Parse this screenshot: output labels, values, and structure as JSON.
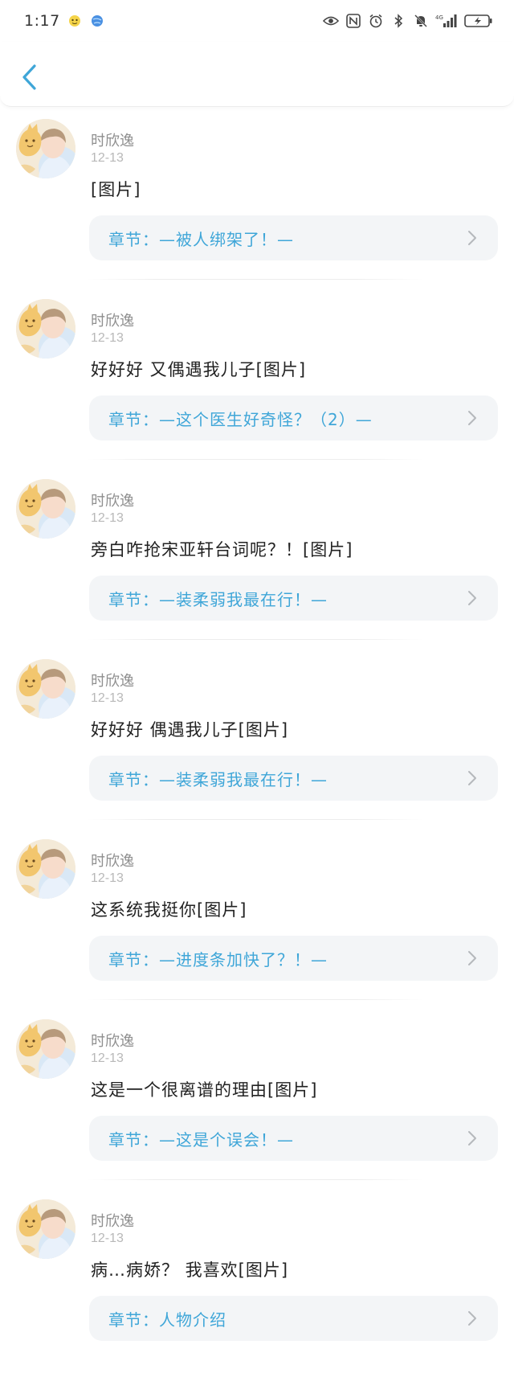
{
  "status_bar": {
    "time": "1:17",
    "network": "4G",
    "icons": [
      "face-icon",
      "globe-icon",
      "eye-icon",
      "nfc-icon",
      "alarm-icon",
      "bluetooth-icon",
      "mute-icon",
      "signal-icon",
      "battery-icon"
    ]
  },
  "header": {
    "back_icon": "chevron-left-icon"
  },
  "colors": {
    "accent": "#3fa6d8",
    "card_bg": "#f3f5f7",
    "author": "#8f8f8f",
    "date": "#b8b8b8"
  },
  "comments": [
    {
      "author": "时欣逸",
      "date": "12-13",
      "text": "[图片]",
      "chapter": "章节：—被人绑架了！—"
    },
    {
      "author": "时欣逸",
      "date": "12-13",
      "text": "好好好 又偶遇我儿子[图片]",
      "chapter": "章节：—这个医生好奇怪？（2）—"
    },
    {
      "author": "时欣逸",
      "date": "12-13",
      "text": "旁白咋抢宋亚轩台词呢？！[图片]",
      "chapter": "章节：—装柔弱我最在行！—"
    },
    {
      "author": "时欣逸",
      "date": "12-13",
      "text": "好好好 偶遇我儿子[图片]",
      "chapter": "章节：—装柔弱我最在行！—"
    },
    {
      "author": "时欣逸",
      "date": "12-13",
      "text": "这系统我挺你[图片]",
      "chapter": "章节：—进度条加快了？！—"
    },
    {
      "author": "时欣逸",
      "date": "12-13",
      "text": "这是一个很离谱的理由[图片]",
      "chapter": "章节：—这是个误会！—"
    },
    {
      "author": "时欣逸",
      "date": "12-13",
      "text": "病…病娇？ 我喜欢[图片]",
      "chapter": "章节：人物介绍"
    }
  ]
}
